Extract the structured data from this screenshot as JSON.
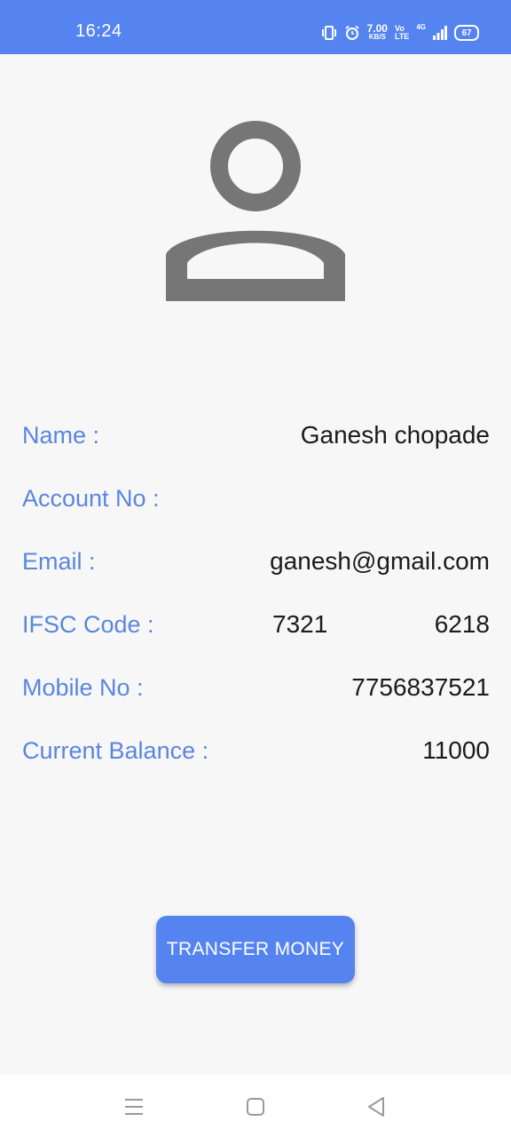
{
  "status_bar": {
    "time": "16:24",
    "speed_value": "7.00",
    "speed_unit": "KB/S",
    "volte_top": "Vo",
    "volte_bottom": "LTE",
    "network": "4G",
    "battery": "67"
  },
  "profile": {
    "avatar_icon": "person-outline-icon",
    "fields": {
      "name": {
        "label": "Name :",
        "value": "Ganesh chopade"
      },
      "account": {
        "label": "Account No :",
        "value": ""
      },
      "email": {
        "label": "Email :",
        "value": "ganesh@gmail.com"
      },
      "ifsc": {
        "label": "IFSC Code :",
        "value": "7321",
        "value2": "6218"
      },
      "mobile": {
        "label": "Mobile No :",
        "value": "7756837521"
      },
      "balance": {
        "label": "Current Balance :",
        "value": "11000"
      }
    }
  },
  "actions": {
    "transfer_label": "TRANSFER MONEY"
  },
  "nav_bar": {
    "icons": [
      "menu-icon",
      "home-square-icon",
      "back-triangle-icon"
    ]
  },
  "colors": {
    "accent": "#5584f1",
    "label": "#5a86e0",
    "avatar": "#767676"
  }
}
